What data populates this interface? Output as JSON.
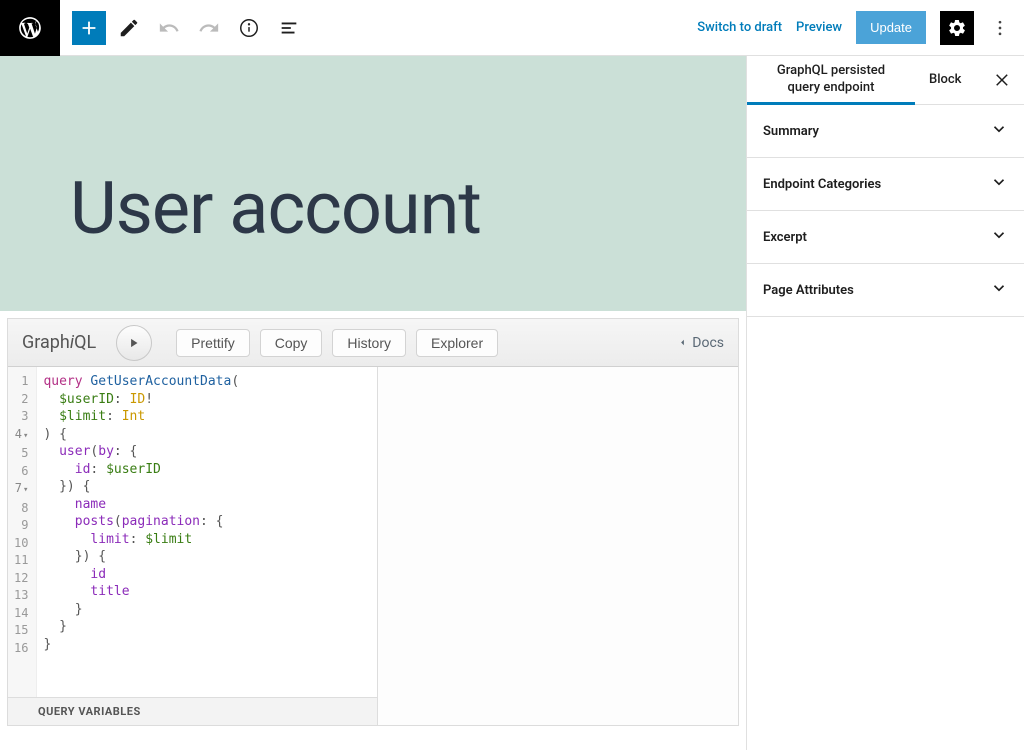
{
  "topbar": {
    "switch_draft": "Switch to draft",
    "preview": "Preview",
    "update": "Update"
  },
  "page": {
    "title": "User account"
  },
  "graphiql": {
    "prettify": "Prettify",
    "copy": "Copy",
    "history": "History",
    "explorer": "Explorer",
    "docs": "Docs",
    "query_vars_label": "QUERY VARIABLES",
    "line_numbers": [
      "1",
      "2",
      "3",
      "4",
      "5",
      "6",
      "7",
      "8",
      "9",
      "10",
      "11",
      "12",
      "13",
      "14",
      "15",
      "16"
    ],
    "fold_lines": [
      4,
      7
    ],
    "code_tokens": [
      [
        [
          "kw",
          "query"
        ],
        [
          "punc",
          " "
        ],
        [
          "def",
          "GetUserAccountData"
        ],
        [
          "punc",
          "("
        ]
      ],
      [
        [
          "punc",
          "  "
        ],
        [
          "var",
          "$userID"
        ],
        [
          "punc",
          ": "
        ],
        [
          "type",
          "ID"
        ],
        [
          "punc",
          "!"
        ]
      ],
      [
        [
          "punc",
          "  "
        ],
        [
          "var",
          "$limit"
        ],
        [
          "punc",
          ": "
        ],
        [
          "type",
          "Int"
        ]
      ],
      [
        [
          "punc",
          ") {"
        ]
      ],
      [
        [
          "punc",
          "  "
        ],
        [
          "attr",
          "user"
        ],
        [
          "punc",
          "("
        ],
        [
          "attr",
          "by"
        ],
        [
          "punc",
          ": {"
        ]
      ],
      [
        [
          "punc",
          "    "
        ],
        [
          "attr",
          "id"
        ],
        [
          "punc",
          ": "
        ],
        [
          "var",
          "$userID"
        ]
      ],
      [
        [
          "punc",
          "  }) {"
        ]
      ],
      [
        [
          "punc",
          "    "
        ],
        [
          "attr",
          "name"
        ]
      ],
      [
        [
          "punc",
          "    "
        ],
        [
          "attr",
          "posts"
        ],
        [
          "punc",
          "("
        ],
        [
          "attr",
          "pagination"
        ],
        [
          "punc",
          ": {"
        ]
      ],
      [
        [
          "punc",
          "      "
        ],
        [
          "attr",
          "limit"
        ],
        [
          "punc",
          ": "
        ],
        [
          "var",
          "$limit"
        ]
      ],
      [
        [
          "punc",
          "    }) {"
        ]
      ],
      [
        [
          "punc",
          "      "
        ],
        [
          "attr",
          "id"
        ]
      ],
      [
        [
          "punc",
          "      "
        ],
        [
          "attr",
          "title"
        ]
      ],
      [
        [
          "punc",
          "    }"
        ]
      ],
      [
        [
          "punc",
          "  }"
        ]
      ],
      [
        [
          "punc",
          "}"
        ]
      ]
    ]
  },
  "sidebar": {
    "tabs": {
      "main": "GraphQL persisted query endpoint",
      "block": "Block"
    },
    "panels": [
      "Summary",
      "Endpoint Categories",
      "Excerpt",
      "Page Attributes"
    ]
  }
}
